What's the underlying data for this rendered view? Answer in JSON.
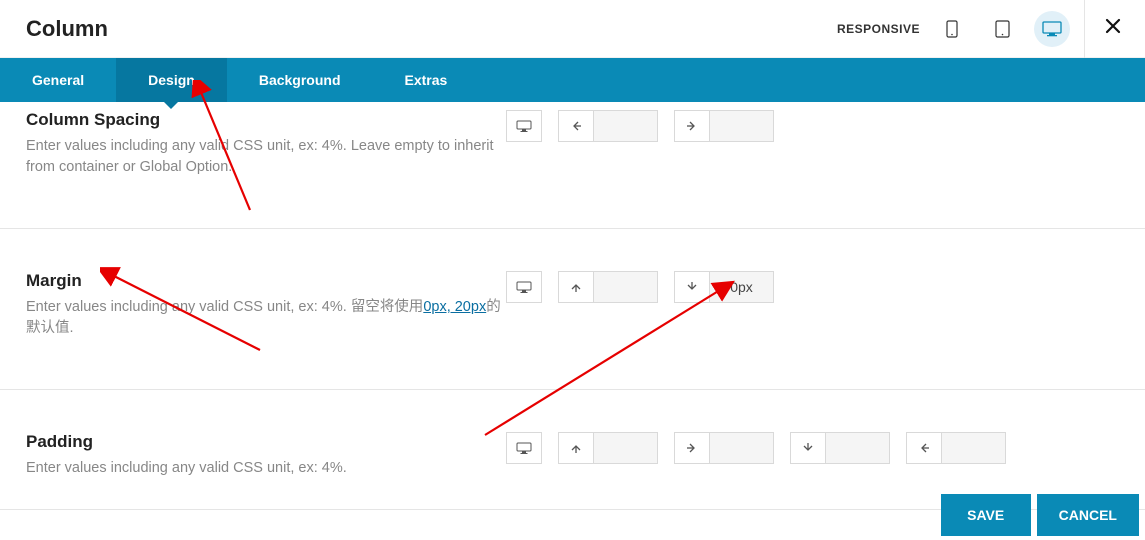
{
  "header": {
    "title": "Column",
    "responsive_label": "RESPONSIVE"
  },
  "tabs": {
    "general": "General",
    "design": "Design",
    "background": "Background",
    "extras": "Extras"
  },
  "sections": {
    "spacing": {
      "title": "Column Spacing",
      "desc": "Enter values including any valid CSS unit, ex: 4%. Leave empty to inherit from container or Global Option.",
      "left_value": "",
      "right_value": ""
    },
    "margin": {
      "title": "Margin",
      "desc_pre": "Enter values including any valid CSS unit, ex: 4%. 留空将使用",
      "link_text": "0px, 20px",
      "desc_post": "的默认值.",
      "top_value": "",
      "bottom_value": "0px"
    },
    "padding": {
      "title": "Padding",
      "desc": "Enter values including any valid CSS unit, ex: 4%.",
      "top_value": "",
      "right_value": "",
      "bottom_value": "",
      "left_value": ""
    }
  },
  "footer": {
    "save": "SAVE",
    "cancel": "CANCEL"
  },
  "colors": {
    "brand": "#0a8ab6",
    "brand_dark": "#0677a0"
  }
}
